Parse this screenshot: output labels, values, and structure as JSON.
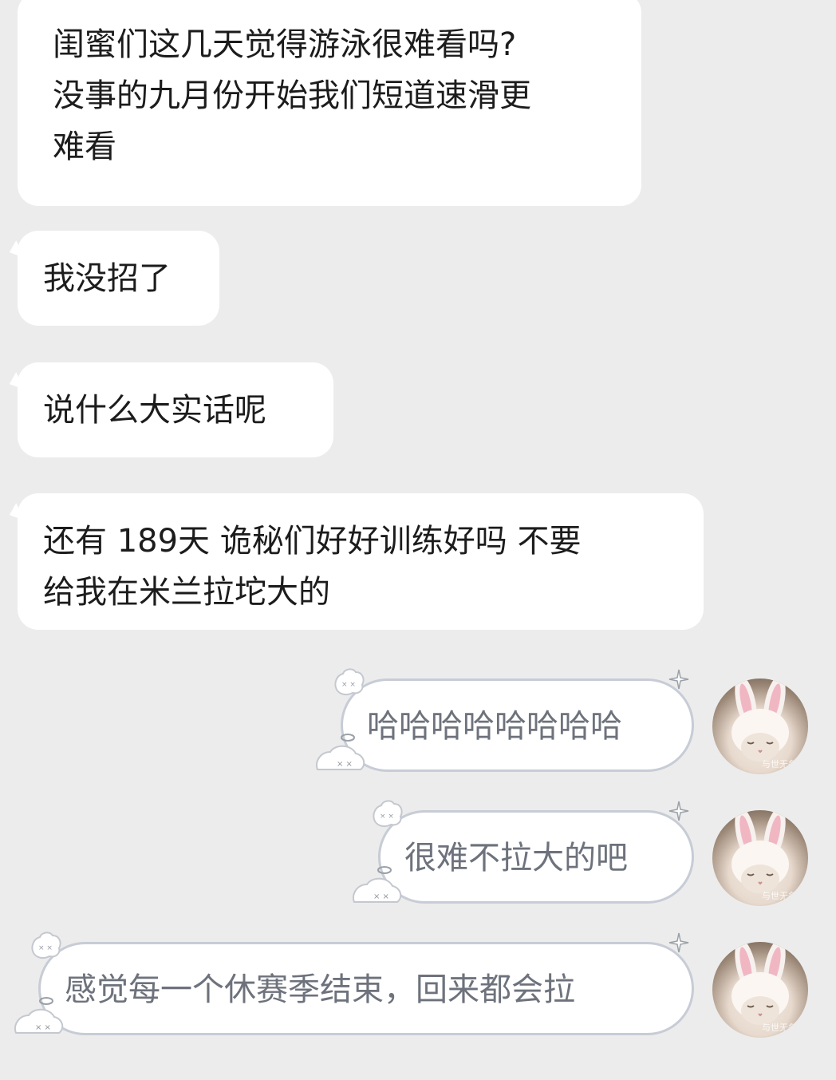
{
  "messages": [
    {
      "side": "left",
      "lines": [
        "闺蜜们这几天觉得游泳很难看吗?",
        "没事的九月份开始我们短道速滑更",
        "难看"
      ]
    },
    {
      "side": "left",
      "lines": [
        "我没招了"
      ]
    },
    {
      "side": "left",
      "lines": [
        "说什么大实话呢"
      ]
    },
    {
      "side": "left",
      "lines": [
        "还有 189天 诡秘们好好训练好吗 不要",
        "给我在米兰拉坨大的"
      ]
    },
    {
      "side": "right",
      "text": "哈哈哈哈哈哈哈哈"
    },
    {
      "side": "right",
      "text": "很难不拉大的吧"
    },
    {
      "side": "right",
      "text": "感觉每一个休赛季结束，回来都会拉"
    }
  ],
  "avatar": {
    "icon": "bunny-ear-cat-avatar-icon",
    "watermark": "与世无争"
  },
  "colors": {
    "background": "#ececec",
    "bubble_left": "#ffffff",
    "bubble_right_border": "#c7ccd6",
    "bubble_right_text": "#6d727c"
  }
}
